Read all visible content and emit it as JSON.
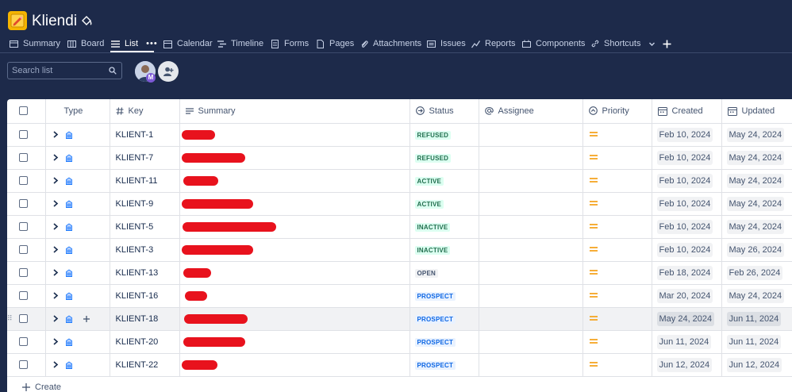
{
  "project": {
    "title": "Kliendi"
  },
  "tabs": [
    {
      "label": "Summary",
      "icon": "summary-icon"
    },
    {
      "label": "Board",
      "icon": "board-icon"
    },
    {
      "label": "List",
      "icon": "list-icon",
      "active": true
    },
    {
      "label": "Calendar",
      "icon": "calendar-icon"
    },
    {
      "label": "Timeline",
      "icon": "timeline-icon"
    },
    {
      "label": "Forms",
      "icon": "forms-icon"
    },
    {
      "label": "Pages",
      "icon": "pages-icon"
    },
    {
      "label": "Attachments",
      "icon": "paperclip-icon"
    },
    {
      "label": "Issues",
      "icon": "issues-icon"
    },
    {
      "label": "Reports",
      "icon": "reports-icon"
    },
    {
      "label": "Components",
      "icon": "components-icon"
    },
    {
      "label": "Shortcuts",
      "icon": "link-icon"
    }
  ],
  "search": {
    "placeholder": "Search list"
  },
  "avatar": {
    "badge": "M"
  },
  "columns": {
    "type": "Type",
    "key": "Key",
    "summary": "Summary",
    "status": "Status",
    "assignee": "Assignee",
    "priority": "Priority",
    "created": "Created",
    "updated": "Updated"
  },
  "rows": [
    {
      "key": "KLIENT-1",
      "status": "REFUSED",
      "status_color": "green",
      "created": "Feb 10, 2024",
      "updated": "May 24, 2024"
    },
    {
      "key": "KLIENT-7",
      "status": "REFUSED",
      "status_color": "green",
      "created": "Feb 10, 2024",
      "updated": "May 24, 2024"
    },
    {
      "key": "KLIENT-11",
      "status": "ACTIVE",
      "status_color": "green",
      "created": "Feb 10, 2024",
      "updated": "May 24, 2024"
    },
    {
      "key": "KLIENT-9",
      "status": "ACTIVE",
      "status_color": "green",
      "created": "Feb 10, 2024",
      "updated": "May 24, 2024"
    },
    {
      "key": "KLIENT-5",
      "status": "INACTIVE",
      "status_color": "green",
      "created": "Feb 10, 2024",
      "updated": "May 24, 2024"
    },
    {
      "key": "KLIENT-3",
      "status": "INACTIVE",
      "status_color": "green",
      "created": "Feb 10, 2024",
      "updated": "May 26, 2024"
    },
    {
      "key": "KLIENT-13",
      "status": "OPEN",
      "status_color": "grey",
      "created": "Feb 18, 2024",
      "updated": "Feb 26, 2024"
    },
    {
      "key": "KLIENT-16",
      "status": "PROSPECT",
      "status_color": "blue",
      "created": "Mar 20, 2024",
      "updated": "May 24, 2024"
    },
    {
      "key": "KLIENT-18",
      "status": "PROSPECT",
      "status_color": "blue",
      "created": "May 24, 2024",
      "updated": "Jun 11, 2024",
      "hover": true
    },
    {
      "key": "KLIENT-20",
      "status": "PROSPECT",
      "status_color": "blue",
      "created": "Jun 11, 2024",
      "updated": "Jun 11, 2024"
    },
    {
      "key": "KLIENT-22",
      "status": "PROSPECT",
      "status_color": "blue",
      "created": "Jun 12, 2024",
      "updated": "Jun 12, 2024"
    }
  ],
  "create": {
    "label": "Create"
  },
  "colors": {
    "brand_dark": "#1d2a4a",
    "redaction": "#e8121d",
    "priority_medium": "#f5a623"
  }
}
